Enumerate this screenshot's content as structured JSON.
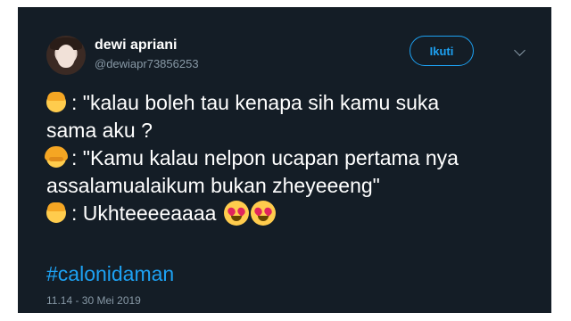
{
  "author": {
    "name": "dewi apriani",
    "handle": "@dewiapr73856253"
  },
  "follow_button": {
    "label": "Ikuti"
  },
  "menu": {
    "icon": "chevron-down-icon"
  },
  "tweet": {
    "lines": [
      {
        "emoji": "boy-emoji",
        "text": ": \"kalau boleh tau kenapa sih kamu suka"
      },
      {
        "emoji": null,
        "text": "sama aku ?"
      },
      {
        "emoji": "girl-emoji",
        "text": ": \"Kamu kalau nelpon ucapan pertama nya"
      },
      {
        "emoji": null,
        "text": "assalamualaikum bukan zheyeeeng\""
      },
      {
        "emoji": "boy-emoji",
        "text": ": Ukhteeeeaaaa",
        "trailing": [
          "heart-eyes-emoji",
          "heart-eyes-emoji"
        ]
      }
    ],
    "hashtag": "#calonidaman",
    "timestamp": "11.14 - 30 Mei 2019"
  },
  "colors": {
    "background": "#141d26",
    "accent": "#1da1f2",
    "muted": "#8899a6"
  }
}
